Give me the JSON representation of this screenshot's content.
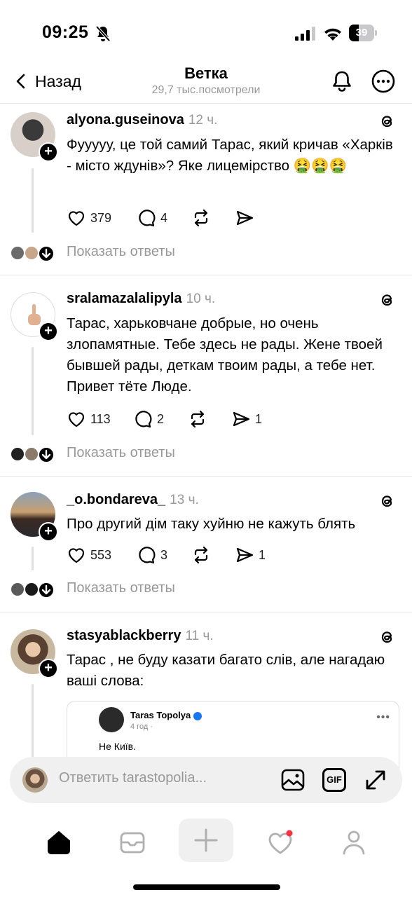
{
  "status": {
    "time": "09:25",
    "battery": "39",
    "battery_level_percent": 39
  },
  "header": {
    "back_label": "Назад",
    "title": "Ветка",
    "subtitle": "29,7 тыс.посмотрели"
  },
  "posts": [
    {
      "username": "alyona.guseinova",
      "time": "12 ч.",
      "text": "Фууууу, це той самий Тарас, який кричав «Харків - місто ждунів»? Яке лицемірство 🤮🤮🤮",
      "likes": "379",
      "comments": "4",
      "reposts": "",
      "shares": "",
      "show_replies": "Показать ответы"
    },
    {
      "username": "sralamazalalipyla",
      "time": "10 ч.",
      "text": "Тарас, харьковчане добрые, но очень злопамятные. Тебе здесь не рады. Жене твоей бывшей рады, деткам твоим рады, а тебе нет. Привет тёте Люде.",
      "likes": "113",
      "comments": "2",
      "reposts": "",
      "shares": "1",
      "show_replies": "Показать ответы"
    },
    {
      "username": "_o.bondareva_",
      "time": "13 ч.",
      "text": "Про другий дім таку хуйню не кажуть блять",
      "likes": "553",
      "comments": "3",
      "reposts": "",
      "shares": "1",
      "show_replies": "Показать ответы"
    },
    {
      "username": "stasyablackberry",
      "time": "11 ч.",
      "text": "Тарас , не буду казати багато слів, але нагадаю ваші слова:",
      "quote": {
        "name": "Taras Topolya",
        "meta": "4 год ·",
        "text": "Не Київ."
      }
    }
  ],
  "reply_bar": {
    "placeholder": "Ответить tarastopolia...",
    "gif_label": "GIF"
  },
  "icons": {
    "colors": {
      "text": "#000000",
      "secondary": "#999999",
      "notification_dot": "#ff3040"
    }
  }
}
